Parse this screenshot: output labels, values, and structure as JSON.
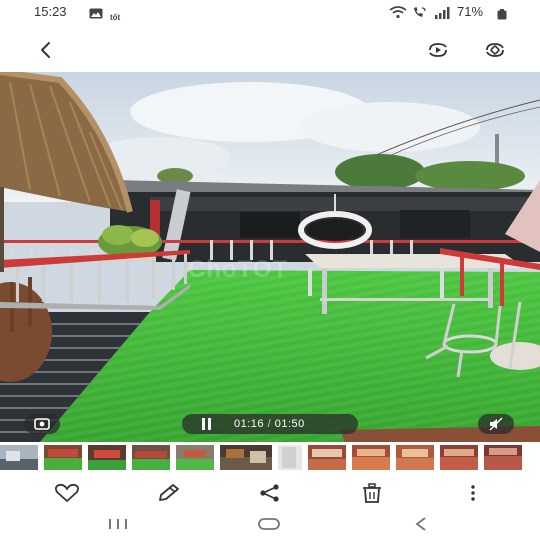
{
  "status_bar": {
    "time": "15:23",
    "battery_text": "71%",
    "icons": [
      "gallery-notification-icon",
      "tiktok-notification-icon",
      "wifi-icon",
      "wifi-calling-icon",
      "signal-icon",
      "battery-icon"
    ]
  },
  "toolbar": {
    "back_icon": "back-arrow-icon",
    "right_icons": [
      "video-player-icon",
      "rotate-screen-icon"
    ]
  },
  "photo": {
    "watermark": "ChoTOT",
    "description_icons": [
      "capture-frame-icon",
      "mute-icon"
    ]
  },
  "player": {
    "current_time": "01:16",
    "separator": "/",
    "total_time": "01:50",
    "state_icon": "pause-icon"
  },
  "thumbnails": {
    "count": 12,
    "current_index": 5
  },
  "actions": {
    "items": [
      "favorite-icon",
      "edit-icon",
      "share-icon",
      "delete-icon",
      "more-options-icon"
    ]
  },
  "nav_bar": {
    "items": [
      "recent-apps-icon",
      "home-icon",
      "back-nav-icon"
    ]
  },
  "colors": {
    "grass": "#43b93a",
    "railing": "#cc3a3a",
    "sky": "#d9e3ec",
    "deck": "#3b3f45"
  }
}
